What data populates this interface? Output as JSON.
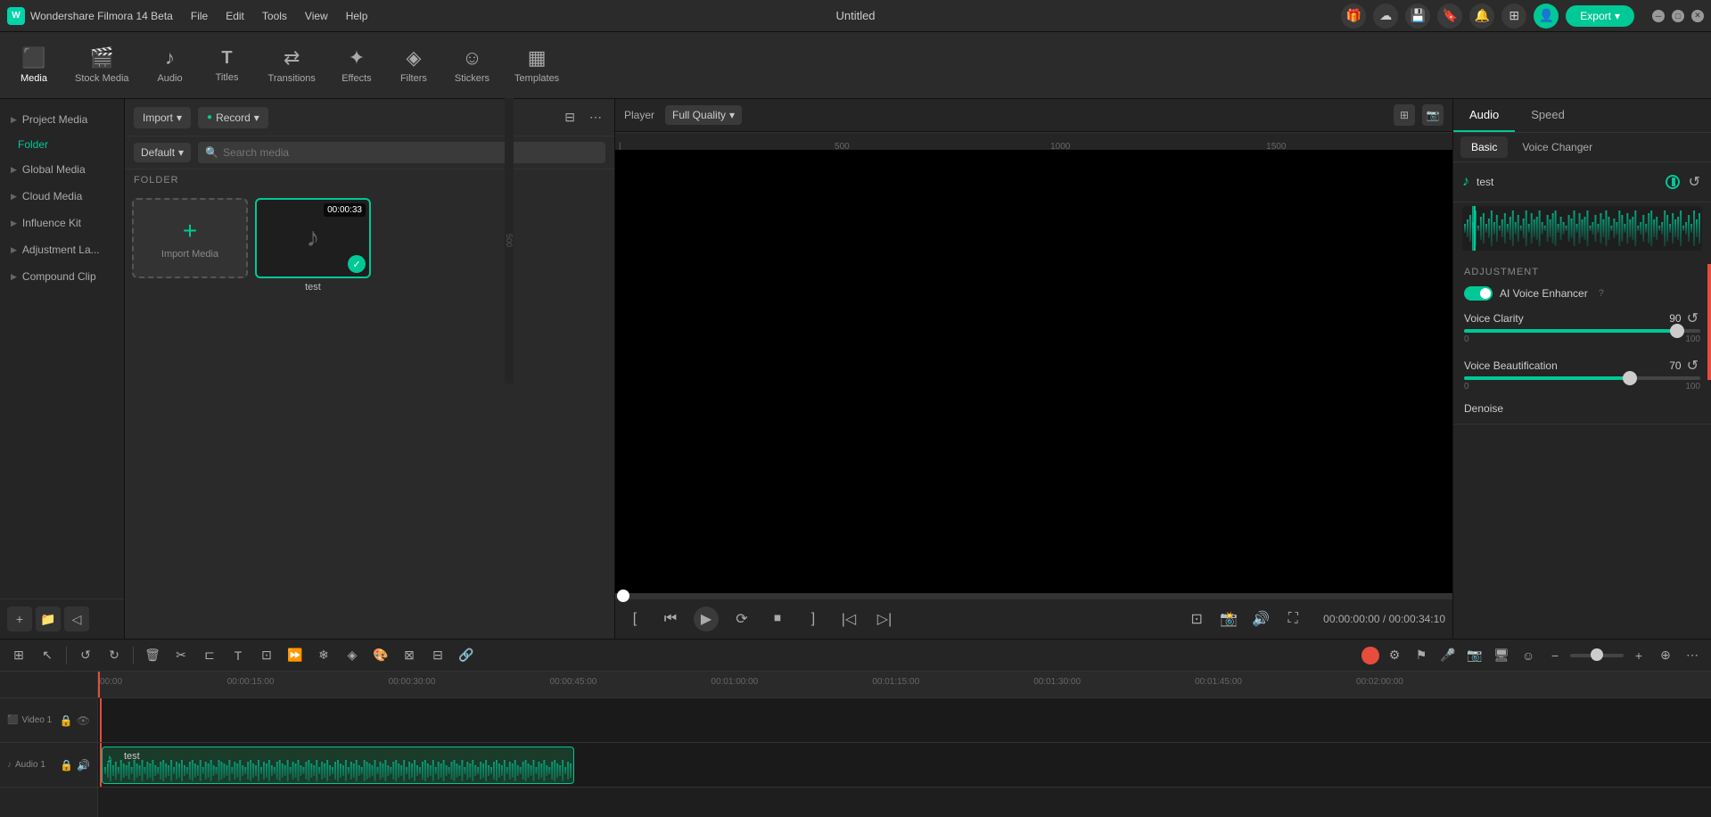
{
  "app": {
    "name": "Wondershare Filmora 14 Beta",
    "title": "Untitled",
    "logo_letter": "W"
  },
  "title_bar": {
    "menus": [
      "File",
      "Edit",
      "Tools",
      "View",
      "Help"
    ],
    "export_label": "Export",
    "window_buttons": [
      "minimize",
      "maximize",
      "close"
    ]
  },
  "toolbar": {
    "items": [
      {
        "id": "media",
        "label": "Media",
        "icon": "⬛"
      },
      {
        "id": "stock-media",
        "label": "Stock Media",
        "icon": "🎬"
      },
      {
        "id": "audio",
        "label": "Audio",
        "icon": "🎵"
      },
      {
        "id": "titles",
        "label": "Titles",
        "icon": "T"
      },
      {
        "id": "transitions",
        "label": "Transitions",
        "icon": "↔"
      },
      {
        "id": "effects",
        "label": "Effects",
        "icon": "✨"
      },
      {
        "id": "filters",
        "label": "Filters",
        "icon": "🎨"
      },
      {
        "id": "stickers",
        "label": "Stickers",
        "icon": "😊"
      },
      {
        "id": "templates",
        "label": "Templates",
        "icon": "📐"
      }
    ],
    "active": "media"
  },
  "sidebar": {
    "items": [
      {
        "id": "project-media",
        "label": "Project Media",
        "expandable": true
      },
      {
        "id": "folder",
        "label": "Folder",
        "is_folder": true
      },
      {
        "id": "global-media",
        "label": "Global Media",
        "expandable": true
      },
      {
        "id": "cloud-media",
        "label": "Cloud Media",
        "expandable": true
      },
      {
        "id": "influence-kit",
        "label": "Influence Kit",
        "expandable": true
      },
      {
        "id": "adjustment-la",
        "label": "Adjustment La...",
        "expandable": true
      },
      {
        "id": "compound-clip",
        "label": "Compound Clip",
        "expandable": true
      }
    ]
  },
  "media_panel": {
    "import_label": "Import",
    "record_label": "Record",
    "filter_label": "Filter",
    "more_label": "More",
    "default_dropdown": "Default",
    "search_placeholder": "Search media",
    "folder_label": "FOLDER",
    "items": [
      {
        "id": "import",
        "type": "import",
        "label": "Import Media"
      },
      {
        "id": "test",
        "type": "audio",
        "name": "test",
        "duration": "00:00:33",
        "checked": true
      }
    ]
  },
  "player": {
    "label": "Player",
    "quality": "Full Quality",
    "time_current": "00:00:00:00",
    "time_total": "00:00:34:10",
    "scrubber_position": 0
  },
  "right_panel": {
    "tabs": [
      "Audio",
      "Speed"
    ],
    "active_tab": "Audio",
    "subtabs": [
      "Basic",
      "Voice Changer"
    ],
    "active_subtab": "Basic",
    "audio_file": {
      "name": "test",
      "icon": "🎵"
    },
    "adjustment": {
      "title": "Adjustment",
      "ai_voice_enhancer": {
        "label": "AI Voice Enhancer",
        "enabled": true
      },
      "voice_clarity": {
        "label": "Voice Clarity",
        "value": 90,
        "min": 0,
        "max": 100,
        "position_pct": 90
      },
      "voice_beautification": {
        "label": "Voice Beautification",
        "value": 70,
        "min": 0,
        "max": 100,
        "position_pct": 70
      },
      "denoise": {
        "label": "Denoise"
      }
    }
  },
  "timeline": {
    "toolbar_buttons": [
      "add-track",
      "select",
      "undo",
      "redo",
      "delete",
      "cut",
      "split-audio",
      "text",
      "crop",
      "speed",
      "freeze",
      "mask",
      "color",
      "group",
      "ungroup",
      "link"
    ],
    "tracks": [
      {
        "id": "video-1",
        "label": "Video 1"
      },
      {
        "id": "audio-1",
        "label": "Audio 1"
      }
    ],
    "ruler_marks": [
      "00:00",
      "00:15:00",
      "00:30:00",
      "00:45:00",
      "01:00:00",
      "01:15:00"
    ],
    "audio_clip": {
      "label": "test",
      "color": "#00c896"
    },
    "playhead_position": "00:00"
  }
}
